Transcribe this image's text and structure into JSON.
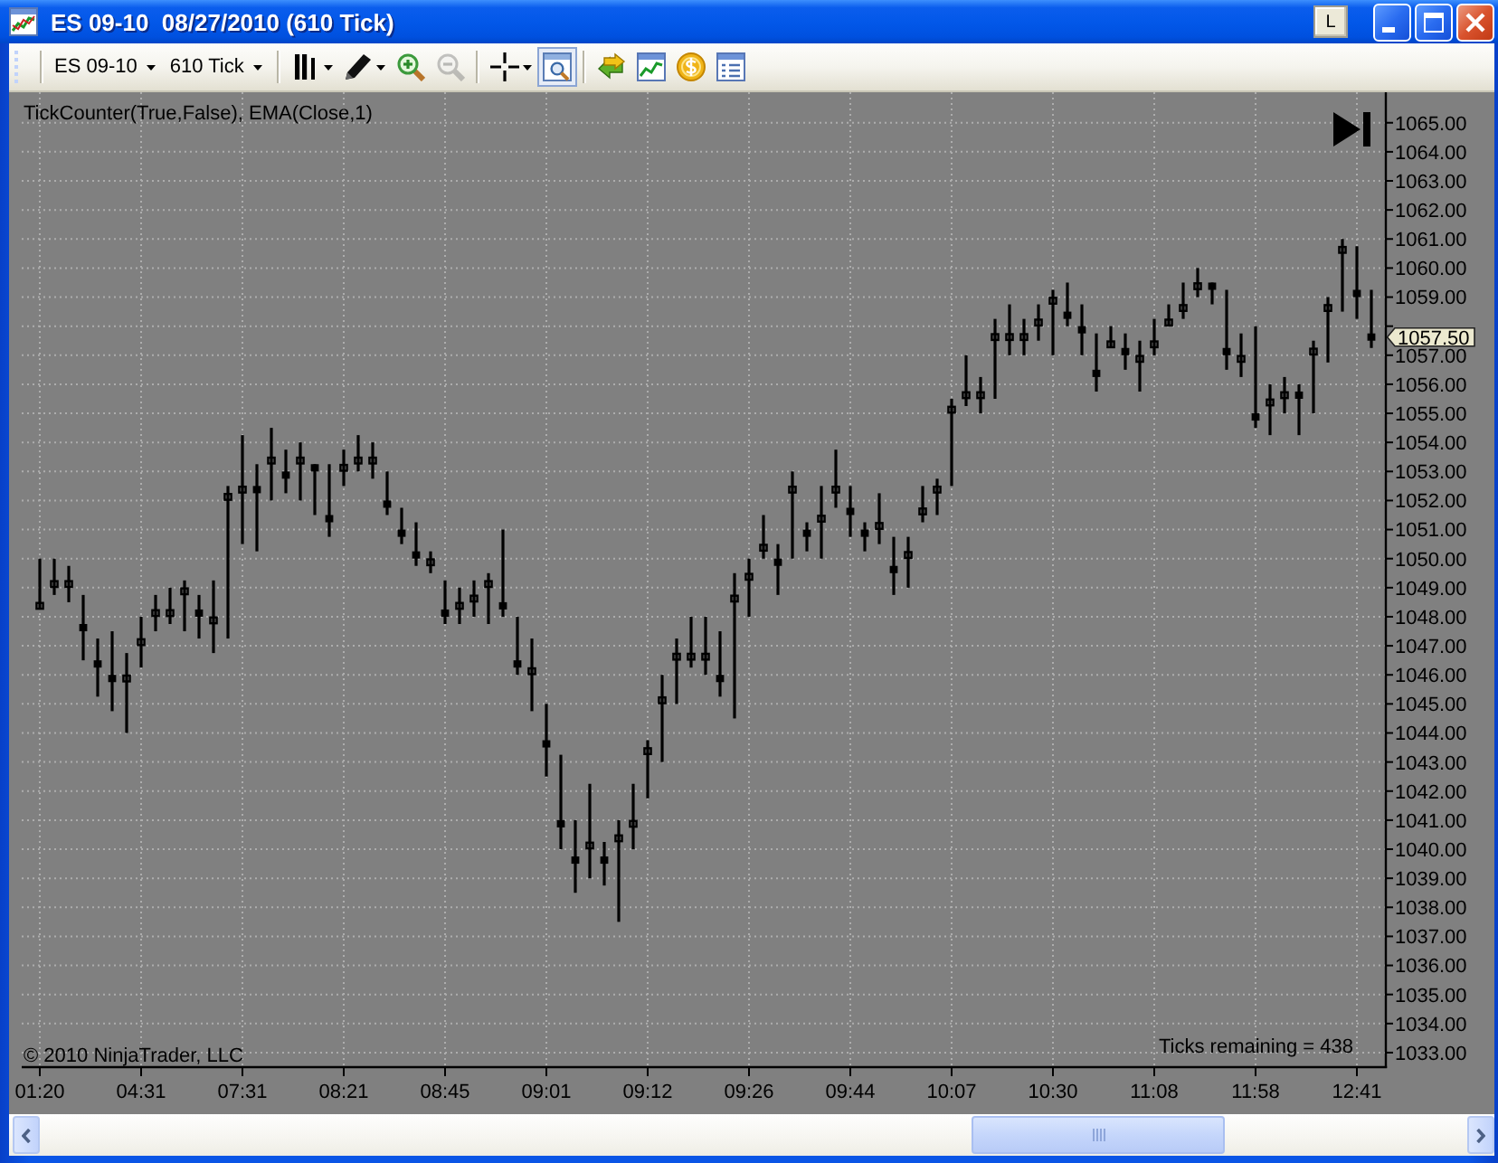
{
  "window": {
    "title": "ES 09-10  08/27/2010 (610 Tick)",
    "link_button": "L"
  },
  "toolbar": {
    "instrument": "ES 09-10",
    "interval": "610 Tick",
    "tool_groups": [
      [
        {
          "kind": "bars",
          "dropdown": true,
          "selected": false,
          "disabled": false
        },
        {
          "kind": "pencil",
          "dropdown": true,
          "selected": false,
          "disabled": false
        },
        {
          "kind": "zoom-in",
          "dropdown": false,
          "selected": false,
          "disabled": false
        },
        {
          "kind": "zoom-out",
          "dropdown": false,
          "selected": false,
          "disabled": true
        }
      ],
      [
        {
          "kind": "crosshair",
          "dropdown": true,
          "selected": false,
          "disabled": false
        },
        {
          "kind": "data-box",
          "dropdown": false,
          "selected": true,
          "disabled": false
        }
      ],
      [
        {
          "kind": "strategy",
          "dropdown": false,
          "selected": false,
          "disabled": false
        },
        {
          "kind": "chart",
          "dropdown": false,
          "selected": false,
          "disabled": false
        },
        {
          "kind": "coin",
          "dropdown": false,
          "selected": false,
          "disabled": false
        },
        {
          "kind": "properties",
          "dropdown": false,
          "selected": false,
          "disabled": false
        }
      ]
    ]
  },
  "chart": {
    "indicator_label": "TickCounter(True,False), EMA(Close,1)",
    "chart_data": {
      "type": "candlestick",
      "grid": true,
      "categories": [
        "01:20",
        null,
        null,
        null,
        null,
        null,
        null,
        "04:31",
        null,
        null,
        null,
        null,
        null,
        null,
        "07:31",
        null,
        null,
        null,
        null,
        null,
        null,
        "08:21",
        null,
        null,
        null,
        null,
        null,
        null,
        "08:45",
        null,
        null,
        null,
        null,
        null,
        null,
        "09:01",
        null,
        null,
        null,
        null,
        null,
        null,
        "09:12",
        null,
        null,
        null,
        null,
        null,
        null,
        "09:26",
        null,
        null,
        null,
        null,
        null,
        null,
        "09:44",
        null,
        null,
        null,
        null,
        null,
        null,
        "10:07",
        null,
        null,
        null,
        null,
        null,
        null,
        "10:30",
        null,
        null,
        null,
        null,
        null,
        null,
        "11:08",
        null,
        null,
        null,
        null,
        null,
        null,
        "11:58",
        null,
        null,
        null,
        null,
        null,
        null,
        "12:41",
        null
      ],
      "ohlc": [
        [
          1048.25,
          1050,
          1048.25,
          1048.5
        ],
        [
          1049,
          1050,
          1048.75,
          1049.25
        ],
        [
          1049,
          1049.75,
          1048.5,
          1049.25
        ],
        [
          1047.75,
          1048.75,
          1046.5,
          1047.5
        ],
        [
          1046.5,
          1047.25,
          1045.25,
          1046.25
        ],
        [
          1046,
          1047.5,
          1044.75,
          1045.75
        ],
        [
          1045.75,
          1046.75,
          1044,
          1046
        ],
        [
          1047,
          1048,
          1046.25,
          1047.25
        ],
        [
          1048,
          1048.75,
          1047.5,
          1048.25
        ],
        [
          1048,
          1049,
          1047.75,
          1048.25
        ],
        [
          1048.75,
          1049.25,
          1047.5,
          1049
        ],
        [
          1048.25,
          1048.75,
          1047.25,
          1048
        ],
        [
          1047.75,
          1049.25,
          1046.75,
          1048
        ],
        [
          1052,
          1052.5,
          1047.25,
          1052.25
        ],
        [
          1052.25,
          1054.25,
          1050.5,
          1052.5
        ],
        [
          1052.5,
          1053.25,
          1050.25,
          1052.25
        ],
        [
          1053.25,
          1054.5,
          1052,
          1053.5
        ],
        [
          1053,
          1053.75,
          1052.25,
          1052.75
        ],
        [
          1053.25,
          1054,
          1052,
          1053.5
        ],
        [
          1053.25,
          1053.25,
          1051.5,
          1053
        ],
        [
          1051.5,
          1053.25,
          1050.75,
          1051.25
        ],
        [
          1053,
          1053.75,
          1052.5,
          1053.25
        ],
        [
          1053.25,
          1054.25,
          1053,
          1053.5
        ],
        [
          1053.25,
          1054,
          1052.75,
          1053.5
        ],
        [
          1052,
          1053,
          1051.5,
          1051.75
        ],
        [
          1051,
          1051.75,
          1050.5,
          1050.75
        ],
        [
          1050.25,
          1051.25,
          1049.75,
          1050
        ],
        [
          1049.75,
          1050.25,
          1049.5,
          1050
        ],
        [
          1048.25,
          1049.25,
          1047.75,
          1048
        ],
        [
          1048.25,
          1049,
          1047.75,
          1048.5
        ],
        [
          1048.5,
          1049.25,
          1048,
          1048.75
        ],
        [
          1049,
          1049.5,
          1047.75,
          1049.25
        ],
        [
          1048.5,
          1051,
          1048,
          1048.25
        ],
        [
          1046.5,
          1048,
          1046,
          1046.25
        ],
        [
          1046,
          1047.25,
          1044.75,
          1046.25
        ],
        [
          1043.75,
          1045,
          1042.5,
          1043.5
        ],
        [
          1041,
          1043.25,
          1040,
          1040.75
        ],
        [
          1039.75,
          1041,
          1038.5,
          1039.5
        ],
        [
          1040,
          1042.25,
          1039,
          1040.25
        ],
        [
          1039.75,
          1040.25,
          1038.75,
          1039.5
        ],
        [
          1040.25,
          1041,
          1037.5,
          1040.5
        ],
        [
          1040.75,
          1042.25,
          1040,
          1041
        ],
        [
          1043.25,
          1043.75,
          1041.75,
          1043.5
        ],
        [
          1045,
          1046,
          1043,
          1045.25
        ],
        [
          1046.5,
          1047.25,
          1045,
          1046.75
        ],
        [
          1046.5,
          1048,
          1046.25,
          1046.75
        ],
        [
          1046.5,
          1048,
          1046,
          1046.75
        ],
        [
          1046,
          1047.5,
          1045.25,
          1045.75
        ],
        [
          1048.5,
          1049.5,
          1044.5,
          1048.75
        ],
        [
          1049.25,
          1050,
          1048,
          1049.5
        ],
        [
          1050.25,
          1051.5,
          1050,
          1050.5
        ],
        [
          1050,
          1050.5,
          1048.75,
          1049.75
        ],
        [
          1052.25,
          1053,
          1050,
          1052.5
        ],
        [
          1051,
          1051.25,
          1050.25,
          1050.75
        ],
        [
          1051.25,
          1052.5,
          1050,
          1051.5
        ],
        [
          1052.25,
          1053.75,
          1051.75,
          1052.5
        ],
        [
          1051.75,
          1052.5,
          1050.75,
          1051.5
        ],
        [
          1051,
          1051.25,
          1050.25,
          1050.75
        ],
        [
          1051,
          1052.25,
          1050.5,
          1051.25
        ],
        [
          1049.75,
          1050.75,
          1048.75,
          1049.5
        ],
        [
          1050,
          1050.75,
          1049,
          1050.25
        ],
        [
          1051.5,
          1052.5,
          1051.25,
          1051.75
        ],
        [
          1052.25,
          1052.75,
          1051.5,
          1052.5
        ],
        [
          1055,
          1055.5,
          1052.5,
          1055.25
        ],
        [
          1055.5,
          1057,
          1055.25,
          1055.75
        ],
        [
          1055.5,
          1056.25,
          1055,
          1055.75
        ],
        [
          1057.5,
          1058.25,
          1055.5,
          1057.75
        ],
        [
          1057.5,
          1058.75,
          1057,
          1057.75
        ],
        [
          1057.5,
          1058.25,
          1057,
          1057.75
        ],
        [
          1058,
          1058.75,
          1057.5,
          1058.25
        ],
        [
          1058.75,
          1059.25,
          1057,
          1059
        ],
        [
          1058.5,
          1059.5,
          1058,
          1058.25
        ],
        [
          1058,
          1058.75,
          1057,
          1057.75
        ],
        [
          1056.5,
          1057.75,
          1055.75,
          1056.25
        ],
        [
          1057.25,
          1058,
          1057.25,
          1057.5
        ],
        [
          1057.25,
          1057.75,
          1056.5,
          1057
        ],
        [
          1056.75,
          1057.5,
          1055.75,
          1057
        ],
        [
          1057.25,
          1058.25,
          1057,
          1057.5
        ],
        [
          1058,
          1058.75,
          1058,
          1058.25
        ],
        [
          1058.5,
          1059.5,
          1058.25,
          1058.75
        ],
        [
          1059.25,
          1060,
          1059,
          1059.5
        ],
        [
          1059.5,
          1059.5,
          1058.75,
          1059.25
        ],
        [
          1057.25,
          1059.25,
          1056.5,
          1057
        ],
        [
          1056.75,
          1057.75,
          1056.25,
          1057
        ],
        [
          1055,
          1058,
          1054.5,
          1054.75
        ],
        [
          1055.25,
          1056,
          1054.25,
          1055.5
        ],
        [
          1055.5,
          1056.25,
          1055,
          1055.75
        ],
        [
          1055.75,
          1056,
          1054.25,
          1055.5
        ],
        [
          1057,
          1057.5,
          1055,
          1057.25
        ],
        [
          1058.5,
          1059,
          1056.75,
          1058.75
        ],
        [
          1060.5,
          1061,
          1058.5,
          1060.75
        ],
        [
          1059.25,
          1060.75,
          1058.25,
          1059
        ],
        [
          1057.75,
          1059.25,
          1057.25,
          1057.5
        ]
      ],
      "ylim": [
        1032.5,
        1066.05
      ],
      "yticks": [
        {
          "value": 1065,
          "label": "1065.00"
        },
        {
          "value": 1064,
          "label": "1064.00"
        },
        {
          "value": 1063,
          "label": "1063.00"
        },
        {
          "value": 1062,
          "label": "1062.00"
        },
        {
          "value": 1061,
          "label": "1061.00"
        },
        {
          "value": 1060,
          "label": "1060.00"
        },
        {
          "value": 1059,
          "label": "1059.00"
        },
        {
          "value": 1057,
          "label": "1057.00"
        },
        {
          "value": 1056,
          "label": "1056.00"
        },
        {
          "value": 1055,
          "label": "1055.00"
        },
        {
          "value": 1054,
          "label": "1054.00"
        },
        {
          "value": 1053,
          "label": "1053.00"
        },
        {
          "value": 1052,
          "label": "1052.00"
        },
        {
          "value": 1051,
          "label": "1051.00"
        },
        {
          "value": 1050,
          "label": "1050.00"
        },
        {
          "value": 1049,
          "label": "1049.00"
        },
        {
          "value": 1048,
          "label": "1048.00"
        },
        {
          "value": 1047,
          "label": "1047.00"
        },
        {
          "value": 1046,
          "label": "1046.00"
        },
        {
          "value": 1045,
          "label": "1045.00"
        },
        {
          "value": 1044,
          "label": "1044.00"
        },
        {
          "value": 1043,
          "label": "1043.00"
        },
        {
          "value": 1042,
          "label": "1042.00"
        },
        {
          "value": 1041,
          "label": "1041.00"
        },
        {
          "value": 1040,
          "label": "1040.00"
        },
        {
          "value": 1039,
          "label": "1039.00"
        },
        {
          "value": 1038,
          "label": "1038.00"
        },
        {
          "value": 1037,
          "label": "1037.00"
        },
        {
          "value": 1036,
          "label": "1036.00"
        },
        {
          "value": 1035,
          "label": "1035.00"
        },
        {
          "value": 1034,
          "label": "1034.00"
        },
        {
          "value": 1033,
          "label": "1033.00"
        }
      ]
    },
    "last_price_marker": "1057.50",
    "copyright": "© 2010 NinjaTrader, LLC",
    "ticks_remaining": "Ticks remaining = 438"
  }
}
